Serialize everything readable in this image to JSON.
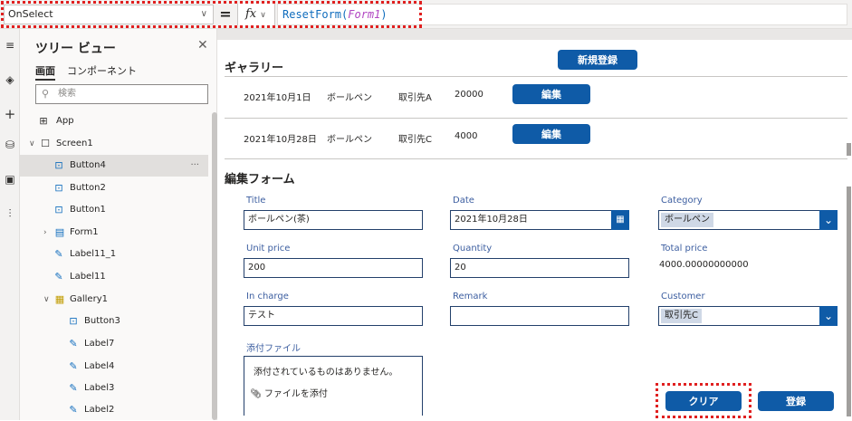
{
  "formula_bar": {
    "property": "OnSelect",
    "equals": "=",
    "fx_label": "fx",
    "formula_func": "ResetForm(",
    "formula_arg": "Form1",
    "formula_close": ")"
  },
  "rail": {
    "icons": [
      "hamburger-icon",
      "layers-icon",
      "plus-icon",
      "database-icon",
      "media-icon",
      "tools-icon"
    ]
  },
  "tree": {
    "title": "ツリー ビュー",
    "tabs": [
      "画面",
      "コンポーネント"
    ],
    "search_placeholder": "検索",
    "items": [
      {
        "label": "App",
        "icon": "app-icon"
      },
      {
        "label": "Screen1",
        "icon": "screen-icon"
      },
      {
        "label": "Button4",
        "icon": "button-icon",
        "more": "···"
      },
      {
        "label": "Button2",
        "icon": "button-icon"
      },
      {
        "label": "Button1",
        "icon": "button-icon"
      },
      {
        "label": "Form1",
        "icon": "form-icon"
      },
      {
        "label": "Label11_1",
        "icon": "label-icon"
      },
      {
        "label": "Label11",
        "icon": "label-icon"
      },
      {
        "label": "Gallery1",
        "icon": "gallery-icon"
      },
      {
        "label": "Button3",
        "icon": "button-icon"
      },
      {
        "label": "Label7",
        "icon": "label-icon"
      },
      {
        "label": "Label4",
        "icon": "label-icon"
      },
      {
        "label": "Label3",
        "icon": "label-icon"
      },
      {
        "label": "Label2",
        "icon": "label-icon"
      }
    ]
  },
  "gallery": {
    "title": "ギャラリー",
    "new_button": "新規登録",
    "rows": [
      {
        "date": "2021年10月1日",
        "item": "ボールペン",
        "vendor": "取引先A",
        "amount": "20000",
        "edit": "編集"
      },
      {
        "date": "2021年10月28日",
        "item": "ボールペン",
        "vendor": "取引先C",
        "amount": "4000",
        "edit": "編集"
      }
    ]
  },
  "form": {
    "title": "編集フォーム",
    "fields": {
      "title": {
        "label": "Title",
        "value": "ボールペン(茶)"
      },
      "date": {
        "label": "Date",
        "value": "2021年10月28日"
      },
      "category": {
        "label": "Category",
        "value": "ボールペン"
      },
      "unit_price": {
        "label": "Unit price",
        "value": "200"
      },
      "quantity": {
        "label": "Quantity",
        "value": "20"
      },
      "total_price": {
        "label": "Total price",
        "value": "4000.00000000000"
      },
      "in_charge": {
        "label": "In charge",
        "value": "テスト"
      },
      "remark": {
        "label": "Remark",
        "value": ""
      },
      "customer": {
        "label": "Customer",
        "value": "取引先C"
      },
      "attachment": {
        "label": "添付ファイル",
        "empty_message": "添付されているものはありません。",
        "add_label": "ファイルを添付"
      }
    },
    "clear_button": "クリア",
    "submit_button": "登録"
  },
  "colors": {
    "accent": "#0f5ba7",
    "highlight": "#e02020"
  }
}
